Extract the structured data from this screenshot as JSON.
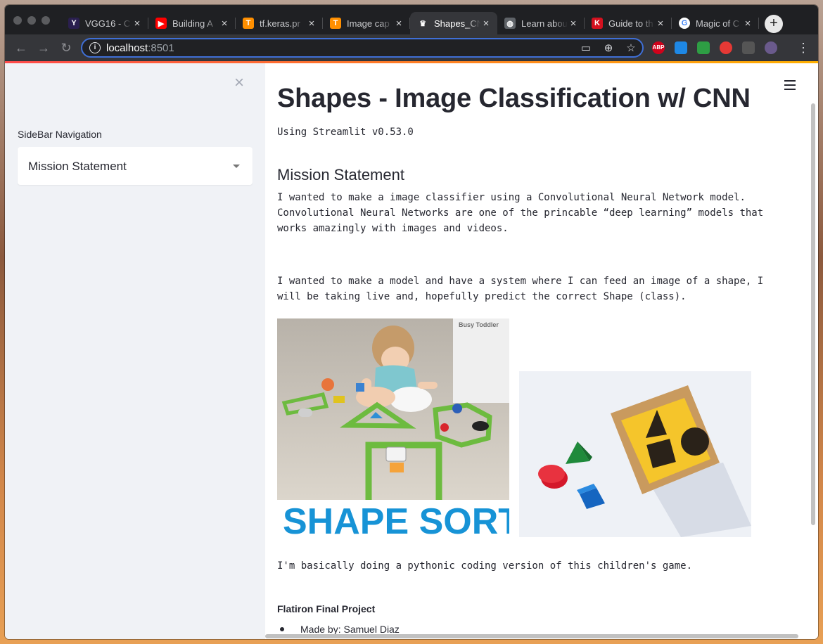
{
  "browser": {
    "tabs": [
      {
        "title": "VGG16 - C",
        "icon": "vgg-favicon",
        "color": "#2a1f4f",
        "glyph": "Y",
        "active": false
      },
      {
        "title": "Building A",
        "icon": "youtube-favicon",
        "color": "#ff0000",
        "glyph": "▶",
        "active": false
      },
      {
        "title": "tf.keras.pr",
        "icon": "tensorflow-favicon",
        "color": "#ff8f00",
        "glyph": "T",
        "active": false
      },
      {
        "title": "Image cap",
        "icon": "tensorflow-favicon",
        "color": "#ff8f00",
        "glyph": "T",
        "active": false
      },
      {
        "title": "Shapes_CN",
        "icon": "streamlit-favicon",
        "color": "#35363a",
        "glyph": "♛",
        "active": true
      },
      {
        "title": "Learn abou",
        "icon": "globe-favicon",
        "color": "#5f6368",
        "glyph": "◍",
        "active": false
      },
      {
        "title": "Guide to th",
        "icon": "kaggle-favicon",
        "color": "#d4111f",
        "glyph": "K",
        "active": false
      },
      {
        "title": "Magic of C",
        "icon": "google-favicon",
        "color": "#ffffff",
        "glyph": "G",
        "active": false
      }
    ],
    "new_tab_label": "+",
    "url_host": "localhost",
    "url_port": ":8501",
    "extensions": [
      {
        "label": "ABP",
        "color": "#d0021b"
      },
      {
        "label": "",
        "color": "#1e88e5"
      },
      {
        "label": "",
        "color": "#2e9e44"
      },
      {
        "label": "",
        "color": "#e53935"
      },
      {
        "label": "",
        "color": "#555555"
      },
      {
        "label": "",
        "color": "#6a5a8c"
      }
    ]
  },
  "sidebar": {
    "close_glyph": "×",
    "nav_label": "SideBar Navigation",
    "select_value": "Mission Statement"
  },
  "main": {
    "title": "Shapes - Image Classification w/ CNN",
    "version": "Using Streamlit v0.53.0",
    "section_title": "Mission Statement",
    "para1": "I wanted to make a image classifier using a Convolutional Neural Network model. Convolutional Neural Networks are one of the princable “deep learning” models that works amazingly with images and videos.",
    "para2": "I wanted to make a model and have a system where I can feed an image of a shape, I will be taking live and, hopefully predict the correct Shape (class).",
    "image_left_watermark": "Busy Toddler",
    "image_left_banner": "SHAPE SORT",
    "caption": "I'm basically doing a pythonic coding version of this children's game.",
    "project_heading": "Flatiron Final Project",
    "made_by": "Made by: Samuel Diaz"
  }
}
